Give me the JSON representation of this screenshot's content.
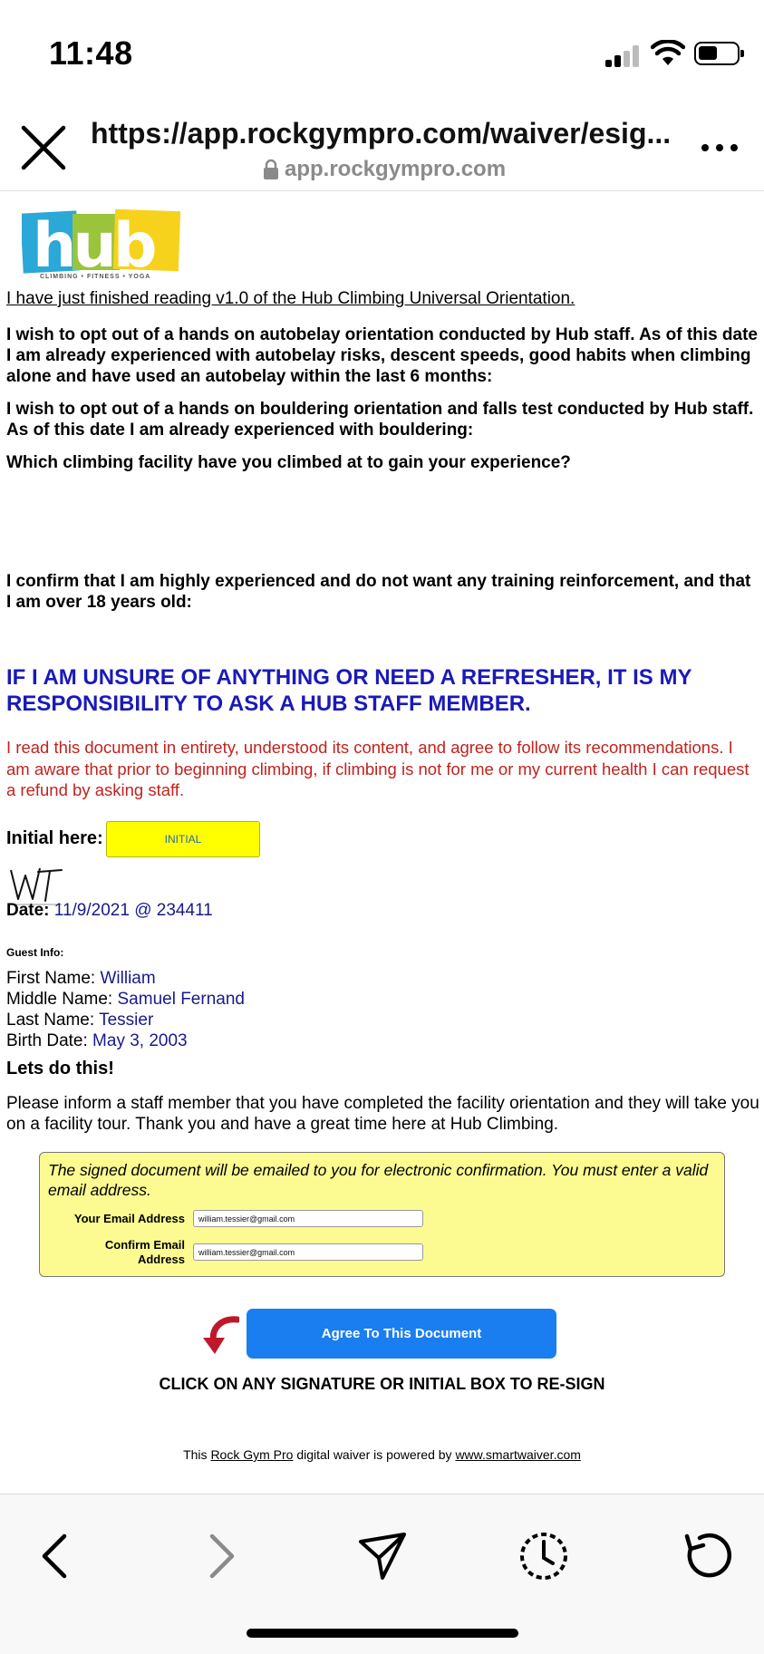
{
  "status_bar": {
    "time": "11:48"
  },
  "browser": {
    "url": "https://app.rockgympro.com/waiver/esig...",
    "domain": "app.rockgympro.com"
  },
  "logo": {
    "text": "hub",
    "tagline": "CLIMBING • FITNESS • YOGA"
  },
  "document": {
    "reading_statement": "I have just finished reading v1.0 of the Hub Climbing Universal Orientation.",
    "autobelay_optout": "I wish to opt out of a hands on autobelay orientation conducted by Hub staff. As of this date I am already experienced with autobelay risks, descent speeds, good habits when climbing alone and have used an autobelay within the last 6 months:",
    "bouldering_optout": "I wish to opt out of a hands on bouldering orientation and falls test conducted by Hub staff. As of this date I am already experienced with bouldering:",
    "facility_question": "Which climbing facility have you climbed at to gain your experience?",
    "confirm_statement": "I confirm that I am highly experienced and do not want any training reinforcement, and that I am over 18 years old:",
    "responsibility_heading": "IF I AM UNSURE OF ANYTHING OR NEED A REFRESHER, IT IS MY RESPONSIBILITY TO ASK A HUB STAFF MEMBER.",
    "agreement_text": "I read this document in entirety, understood its content, and agree to follow its recommendations. I am aware that prior to beginning climbing, if climbing is not for me or my current health I can request a refund by asking staff."
  },
  "initial": {
    "label": "Initial here:",
    "box_text": "INITIAL",
    "signature": "WT"
  },
  "date": {
    "label": "Date:",
    "value": "11/9/2021 @ 234411"
  },
  "guest": {
    "heading": "Guest Info:",
    "first_name_label": "First Name:",
    "first_name": "William",
    "middle_name_label": "Middle Name:",
    "middle_name": "Samuel Fernand",
    "last_name_label": "Last Name:",
    "last_name": "Tessier",
    "birth_date_label": "Birth Date:",
    "birth_date": "May 3, 2003"
  },
  "closing": {
    "heading": "Lets do this!",
    "message": "Please inform a staff member that you have completed the facility orientation and they will take you on a facility tour. Thank you and have a great time here at Hub Climbing."
  },
  "email": {
    "note": "The signed document will be emailed to you for electronic confirmation. You must enter a valid email address.",
    "email_label": "Your Email Address",
    "email_value": "william.tessier@gmail.com",
    "confirm_label_line1": "Confirm Email",
    "confirm_label_line2": "Address",
    "confirm_value": "william.tessier@gmail.com"
  },
  "actions": {
    "agree_label": "Agree To This Document",
    "resign_note": "CLICK ON ANY SIGNATURE OR INITIAL BOX TO RE-SIGN"
  },
  "footer": {
    "prefix": "This",
    "rgp_link": "Rock Gym Pro",
    "middle": "digital waiver is powered by",
    "sw_link": "www.smartwaiver.com"
  },
  "colors": {
    "accent_blue": "#1a7ef0",
    "heading_blue": "#1a1ab8",
    "warning_red": "#c0231e",
    "initial_yellow": "#ffff00",
    "email_box": "#fbfb92"
  }
}
